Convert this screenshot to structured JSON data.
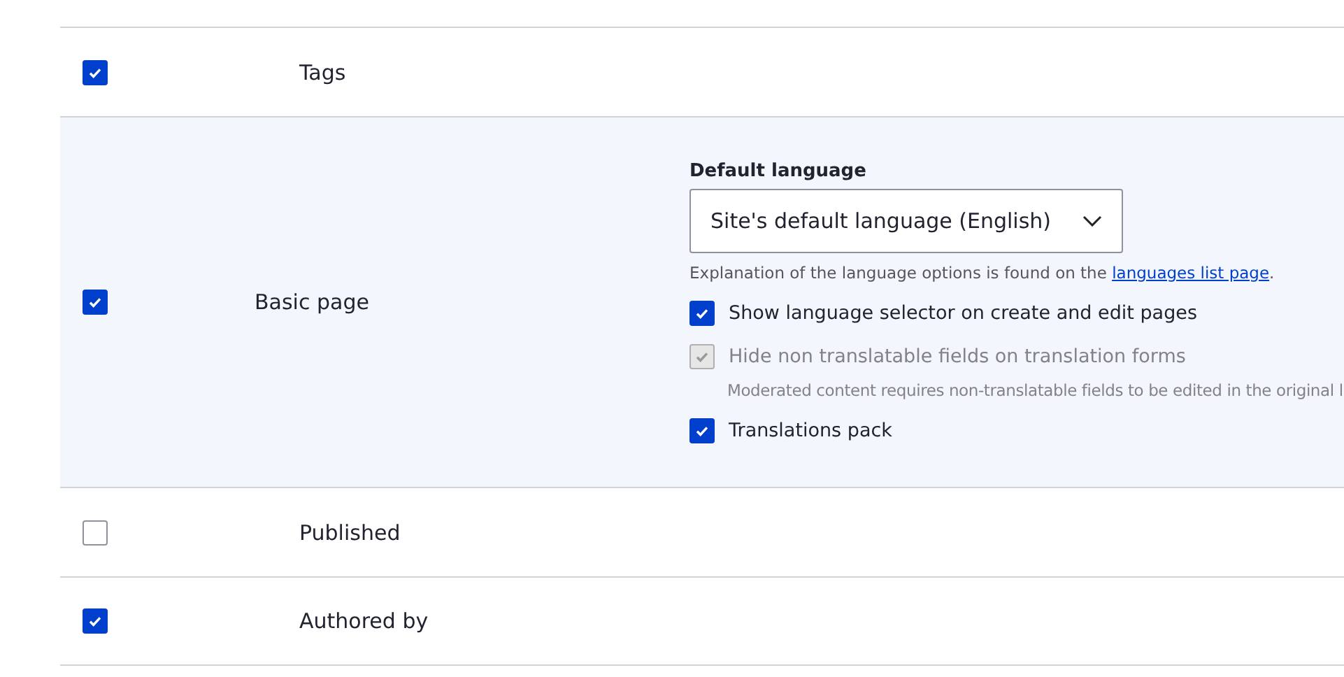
{
  "rows": [
    {
      "kind": "field",
      "label": "Tags",
      "checked": true
    },
    {
      "kind": "bundle",
      "label": "Basic page",
      "checked": true,
      "settings": {
        "select_label": "Default language",
        "select_value": "Site's default language (English)",
        "help_before": "Explanation of the language options is found on the ",
        "help_link": "languages list page",
        "help_after": ".",
        "options": [
          {
            "label": "Show language selector on create and edit pages",
            "checked": true,
            "disabled": false
          },
          {
            "label": "Hide non translatable fields on translation forms",
            "checked": true,
            "disabled": true,
            "description": "Moderated content requires non-translatable fields to be edited in the original l"
          },
          {
            "label": "Translations pack",
            "checked": true,
            "disabled": false
          }
        ]
      }
    },
    {
      "kind": "field",
      "label": "Published",
      "checked": false
    },
    {
      "kind": "field",
      "label": "Authored by",
      "checked": true
    }
  ]
}
